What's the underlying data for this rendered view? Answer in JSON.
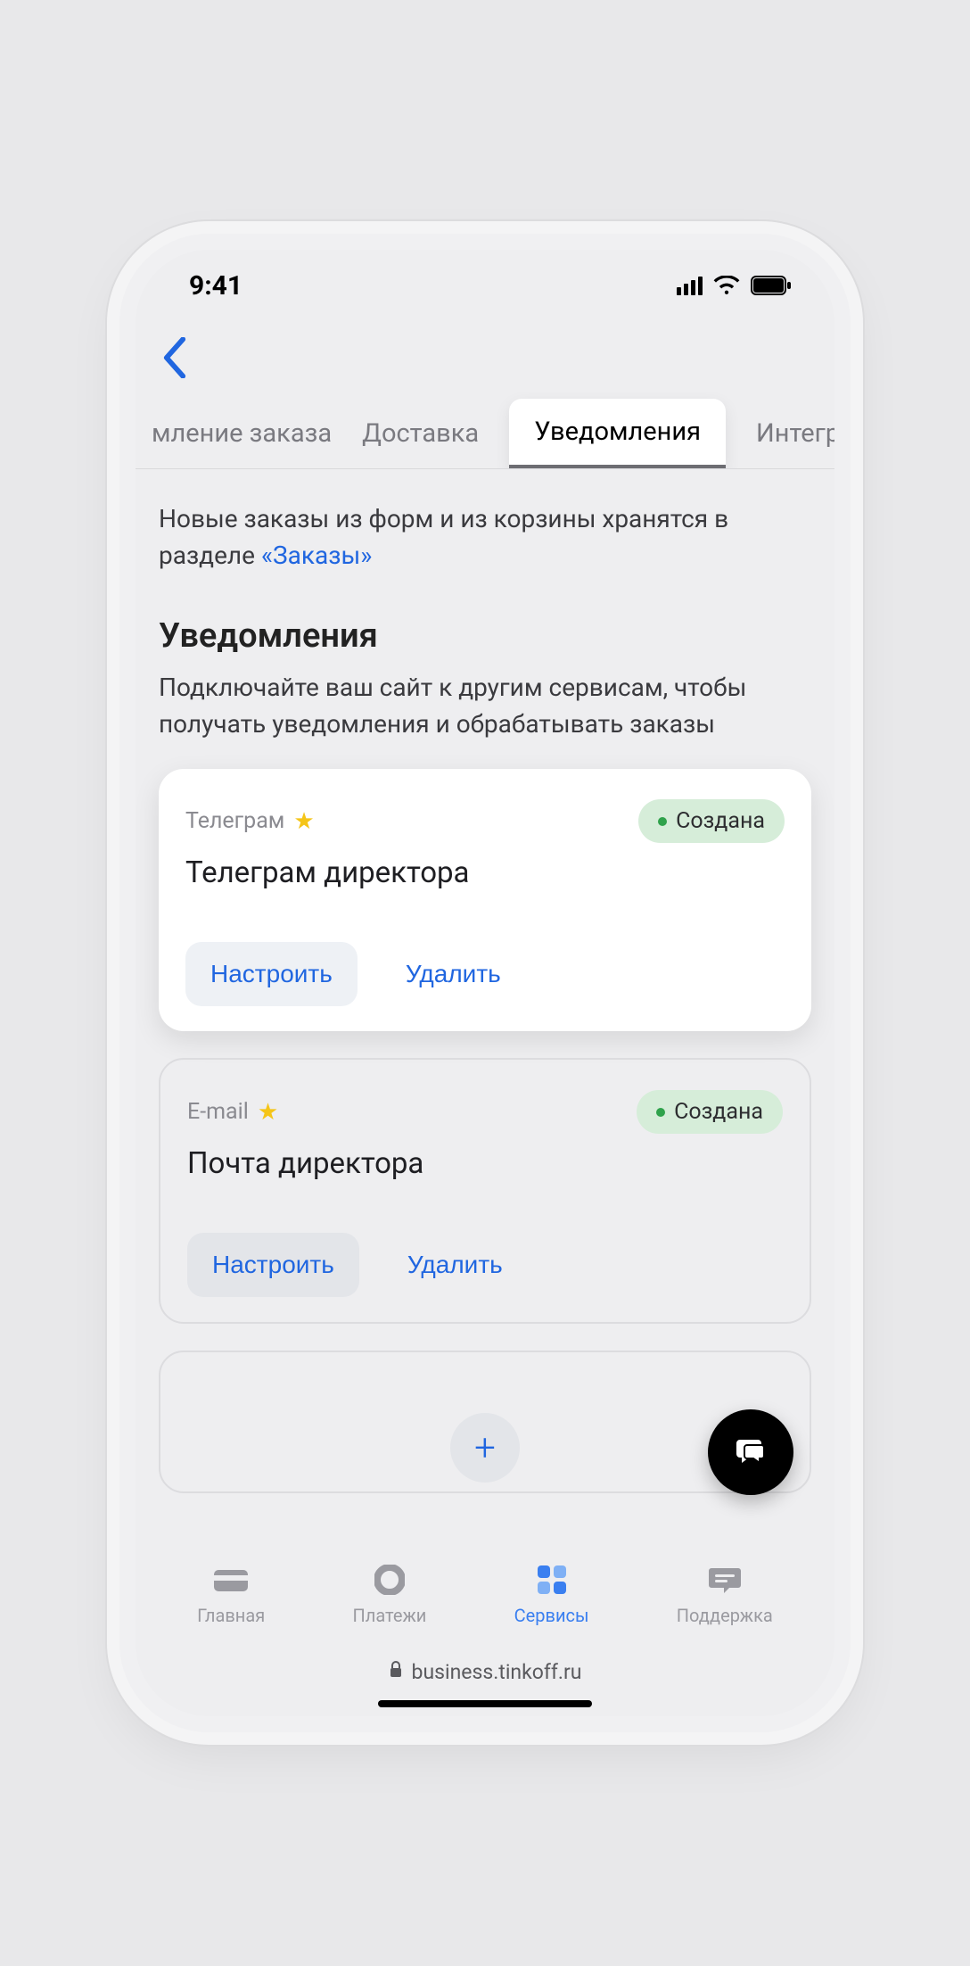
{
  "status": {
    "time": "9:41"
  },
  "tabs": [
    {
      "label": "мление заказа"
    },
    {
      "label": "Доставка"
    },
    {
      "label": "Уведомления"
    },
    {
      "label": "Интеграция"
    }
  ],
  "intro": {
    "text_before": "Новые заказы из форм и из корзины хранятся в разделе ",
    "link": "«Заказы»"
  },
  "section": {
    "title": "Уведомления",
    "desc": "Подключайте ваш сайт к другим сервисам, чтобы получать уведомления и обрабатывать заказы"
  },
  "cards": [
    {
      "label": "Телеграм",
      "title": "Телеграм директора",
      "status": "Создана",
      "actions": {
        "configure": "Настроить",
        "delete": "Удалить"
      }
    },
    {
      "label": "E-mail",
      "title": "Почта директора",
      "status": "Создана",
      "actions": {
        "configure": "Настроить",
        "delete": "Удалить"
      }
    }
  ],
  "bottom_nav": [
    {
      "label": "Главная"
    },
    {
      "label": "Платежи"
    },
    {
      "label": "Сервисы"
    },
    {
      "label": "Поддержка"
    }
  ],
  "url": "business.tinkoff.ru"
}
